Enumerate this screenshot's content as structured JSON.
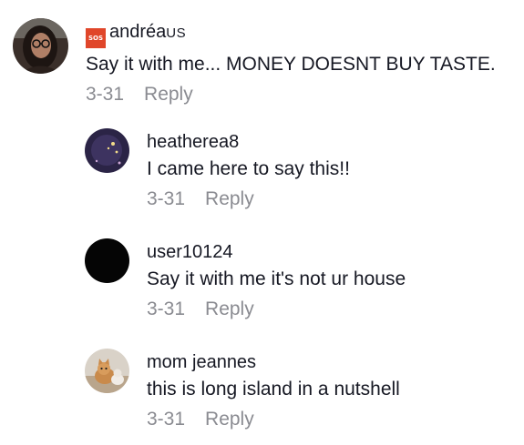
{
  "comments": [
    {
      "username": "andréa",
      "username_suffix": "US",
      "badge_text": "SOS",
      "badge_color": "#e0462a",
      "text": "Say it with me... MONEY DOESNT BUY TASTE.",
      "date": "3-31",
      "reply_label": "Reply",
      "avatar": "portrait-woman-glasses"
    },
    {
      "username": "heatherea8",
      "text": "I came here to say this!!",
      "date": "3-31",
      "reply_label": "Reply",
      "avatar": "moon-stars-art"
    },
    {
      "username": "user10124",
      "text": "Say it with me it's not ur house",
      "date": "3-31",
      "reply_label": "Reply",
      "avatar": "default-black"
    },
    {
      "username": "mom jeannes",
      "text": "this is long island in a nutshell",
      "date": "3-31",
      "reply_label": "Reply",
      "avatar": "cat-photo"
    }
  ],
  "colors": {
    "text_primary": "#161823",
    "text_secondary": "#8a8b91"
  }
}
